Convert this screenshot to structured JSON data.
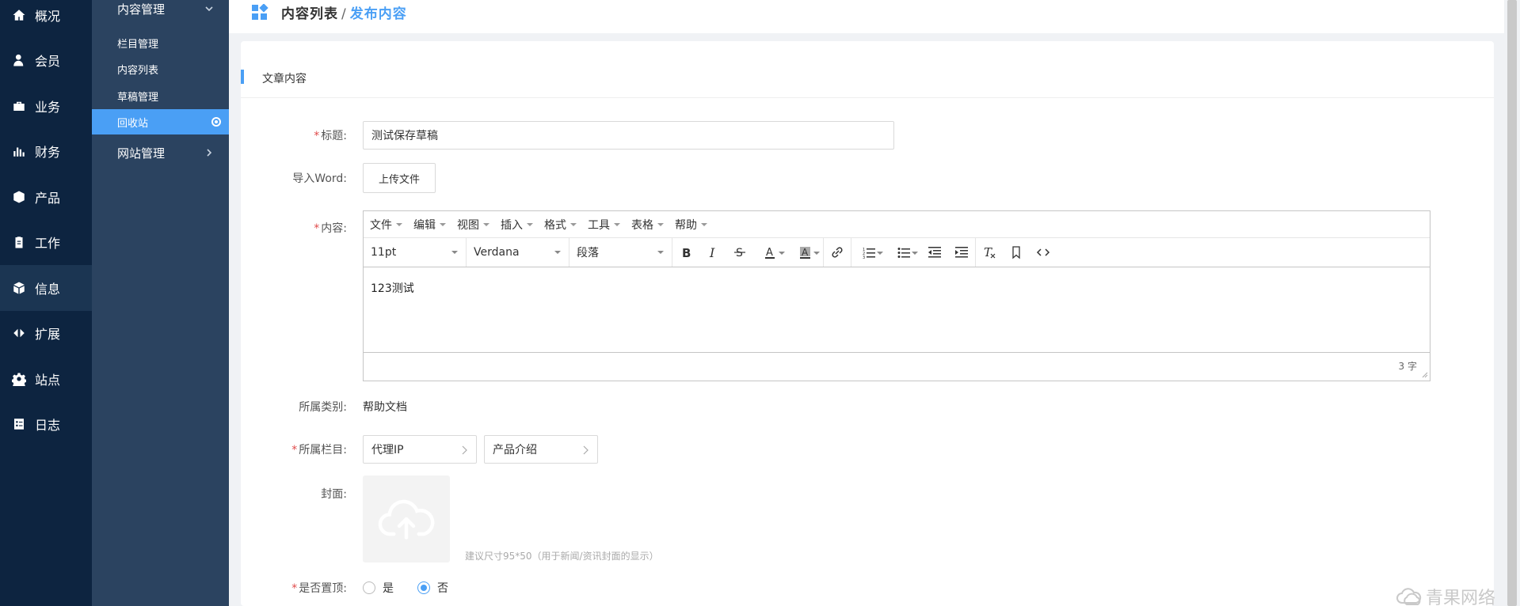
{
  "sidebar_primary": {
    "items": [
      {
        "label": "概况",
        "icon": "home-icon"
      },
      {
        "label": "会员",
        "icon": "user-icon"
      },
      {
        "label": "业务",
        "icon": "briefcase-icon"
      },
      {
        "label": "财务",
        "icon": "bar-chart-icon"
      },
      {
        "label": "产品",
        "icon": "box-icon"
      },
      {
        "label": "工作",
        "icon": "clipboard-icon"
      },
      {
        "label": "信息",
        "icon": "cube-icon",
        "active": true
      },
      {
        "label": "扩展",
        "icon": "arrows-icon"
      },
      {
        "label": "站点",
        "icon": "gear-icon"
      },
      {
        "label": "日志",
        "icon": "checklist-icon"
      }
    ]
  },
  "sidebar_secondary": {
    "group_content": "内容管理",
    "items": [
      "栏目管理",
      "内容列表",
      "草稿管理",
      "回收站"
    ],
    "active_item": "回收站",
    "group_site": "网站管理"
  },
  "breadcrumb": {
    "parent": "内容列表",
    "separator": "/",
    "current": "发布内容"
  },
  "card": {
    "title": "文章内容"
  },
  "form": {
    "title_label": "标题:",
    "title_value": "测试保存草稿",
    "import_label": "导入Word:",
    "upload_button": "上传文件",
    "content_label": "内容:",
    "category_label": "所属类别:",
    "category_value": "帮助文档",
    "column_label": "所属栏目:",
    "column_1": "代理IP",
    "column_2": "产品介绍",
    "cover_label": "封面:",
    "cover_hint": "建议尺寸95*50（用于新闻/资讯封面的显示）",
    "top_label": "是否置顶:",
    "top_yes": "是",
    "top_no": "否",
    "top_selected": "否"
  },
  "editor": {
    "menus": [
      "文件",
      "编辑",
      "视图",
      "插入",
      "格式",
      "工具",
      "表格",
      "帮助"
    ],
    "font_size": "11pt",
    "font_family": "Verdana",
    "block_format": "段落",
    "body_text": "123测试",
    "word_count": "3 字"
  },
  "watermark": "青果网络",
  "colors": {
    "sidebar_primary_bg": "#0d2440",
    "sidebar_secondary_bg": "#2b4360",
    "accent": "#4a9ff5",
    "required": "#e04a4a"
  }
}
